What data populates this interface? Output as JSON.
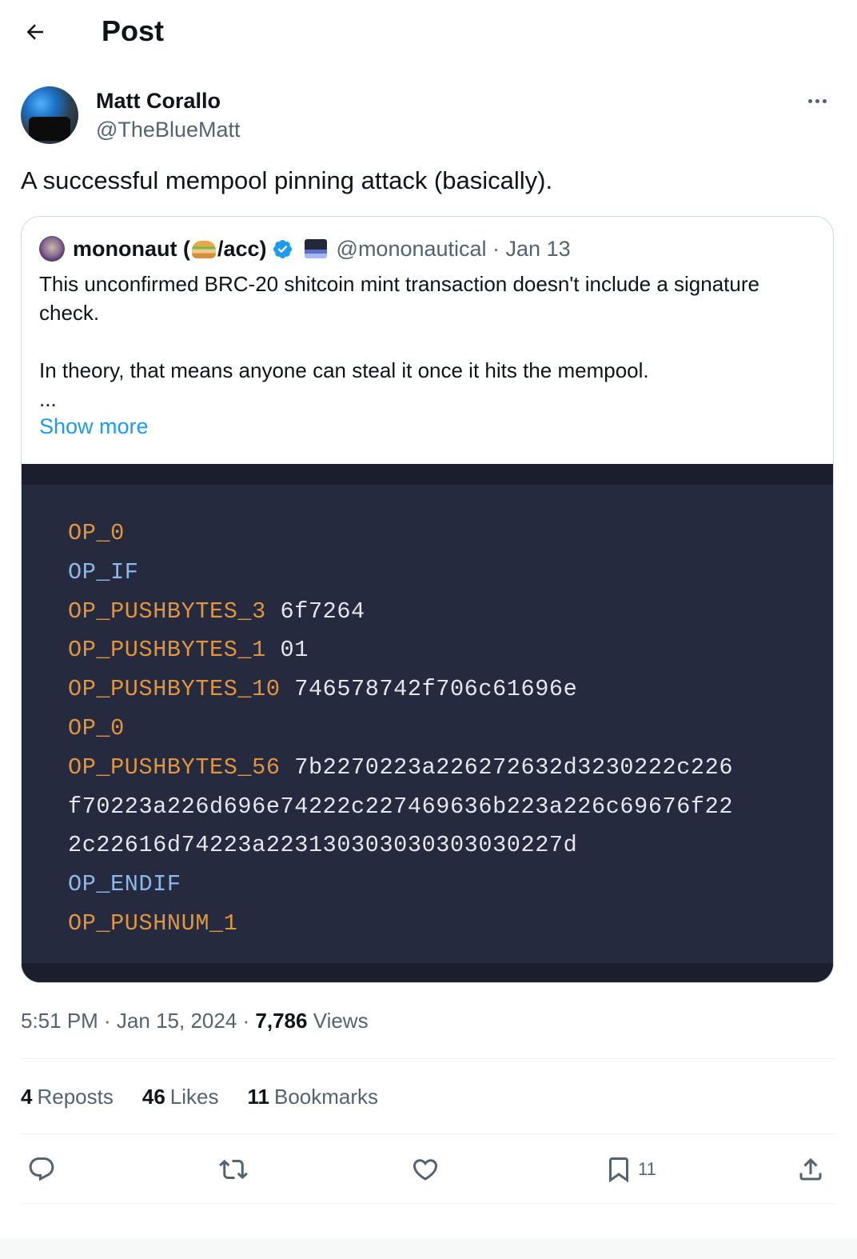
{
  "header": {
    "title": "Post"
  },
  "author": {
    "name": "Matt Corallo",
    "handle": "@TheBlueMatt"
  },
  "tweet": {
    "text": "A successful mempool pinning attack (basically)."
  },
  "quote": {
    "name_prefix": "mononaut (",
    "name_suffix": "/acc)",
    "handle_date": "@mononautical · Jan 13",
    "paragraph1": "This unconfirmed BRC-20 shitcoin mint transaction doesn't include a signature check.",
    "paragraph2": "In theory, that means anyone can steal it once it hits the mempool.",
    "ellipsis": "...",
    "show_more": "Show more",
    "code_lines": [
      {
        "op": "OP_0",
        "arg": "",
        "color": "#e0953e"
      },
      {
        "op": "OP_IF",
        "arg": "",
        "color": "#8ab9e8"
      },
      {
        "op": "OP_PUSHBYTES_3",
        "arg": " 6f7264",
        "color": "#e0953e"
      },
      {
        "op": "OP_PUSHBYTES_1",
        "arg": " 01",
        "color": "#e0953e"
      },
      {
        "op": "OP_PUSHBYTES_10",
        "arg": " 746578742f706c61696e",
        "color": "#e0953e"
      },
      {
        "op": "OP_0",
        "arg": "",
        "color": "#e0953e"
      },
      {
        "op": "OP_PUSHBYTES_56",
        "arg": " 7b2270223a226272632d3230222c226",
        "color": "#e0953e"
      },
      {
        "op": "",
        "arg": "f70223a226d696e74222c227469636b223a226c69676f22",
        "color": "#e0953e"
      },
      {
        "op": "",
        "arg": "2c22616d74223a223130303030303030227d",
        "color": "#e0953e"
      },
      {
        "op": "OP_ENDIF",
        "arg": "",
        "color": "#8ab9e8"
      },
      {
        "op": "OP_PUSHNUM_1",
        "arg": "",
        "color": "#e0953e"
      }
    ]
  },
  "meta": {
    "time_date": "5:51 PM · Jan 15, 2024 · ",
    "views_count": "7,786",
    "views_label": " Views"
  },
  "stats": {
    "reposts_count": "4",
    "reposts_label": "Reposts",
    "likes_count": "46",
    "likes_label": "Likes",
    "bookmarks_count": "11",
    "bookmarks_label": "Bookmarks"
  },
  "actions": {
    "bookmark_count": "11"
  },
  "colors": {
    "text": "#0f1419",
    "secondary": "#536471",
    "link": "#1d9bf0",
    "code_bg": "#252a3e",
    "code_orange": "#e0953e",
    "code_blue": "#8ab9e8"
  }
}
